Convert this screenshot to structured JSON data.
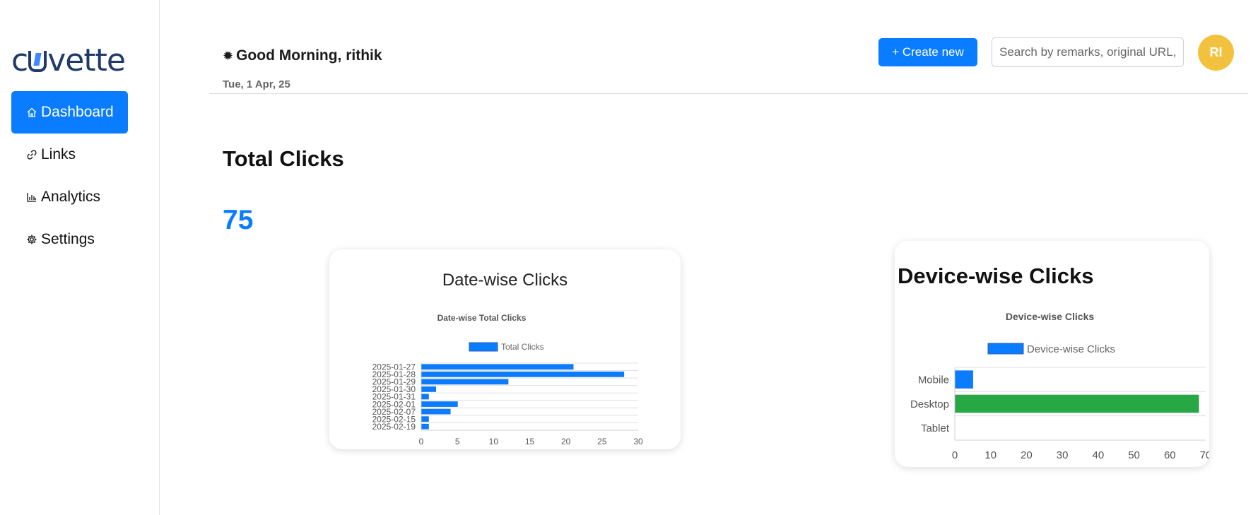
{
  "logo": {
    "text_before": "c",
    "text_after": "vette"
  },
  "sidebar": {
    "items": [
      {
        "label": "Dashboard",
        "icon": "home-icon",
        "active": true
      },
      {
        "label": "Links",
        "icon": "link-icon",
        "active": false
      },
      {
        "label": "Analytics",
        "icon": "bar-chart-icon",
        "active": false
      },
      {
        "label": "Settings",
        "icon": "gear-icon",
        "active": false
      }
    ]
  },
  "header": {
    "greeting": "Good Morning, rithik",
    "date": "Tue, 1 Apr, 25",
    "create_label": "+ Create new",
    "search_placeholder": "Search by remarks, original URL, or short URL",
    "avatar_initials": "RI"
  },
  "summary": {
    "title": "Total Clicks",
    "value": "75"
  },
  "cards": {
    "date_title": "Date-wise Clicks",
    "device_title": "Device-wise Clicks"
  },
  "colors": {
    "accent": "#0a7cff",
    "desktop": "#28a745",
    "avatar": "#f2c13e"
  },
  "chart_data": [
    {
      "type": "bar",
      "orientation": "horizontal",
      "title": "Date-wise Total Clicks",
      "categories": [
        "2025-01-27",
        "2025-01-28",
        "2025-01-29",
        "2025-01-30",
        "2025-01-31",
        "2025-02-01",
        "2025-02-07",
        "2025-02-15",
        "2025-02-19"
      ],
      "series": [
        {
          "name": "Total Clicks",
          "values": [
            21,
            28,
            12,
            2,
            1,
            5,
            4,
            1,
            1
          ],
          "color": "#0a7cff"
        }
      ],
      "xlim": [
        0,
        30
      ],
      "xticks": [
        0,
        5,
        10,
        15,
        20,
        25,
        30
      ],
      "legend": "top",
      "grid": true
    },
    {
      "type": "bar",
      "orientation": "horizontal",
      "title": "Device-wise Clicks",
      "categories": [
        "Mobile",
        "Desktop",
        "Tablet"
      ],
      "series": [
        {
          "name": "Device-wise Clicks",
          "values": [
            5,
            68,
            0
          ],
          "colors": [
            "#0a7cff",
            "#28a745",
            "#0a7cff"
          ]
        }
      ],
      "xlim": [
        0,
        70
      ],
      "xticks": [
        0,
        10,
        20,
        30,
        40,
        50,
        60,
        70
      ],
      "legend": "top",
      "grid": true
    }
  ]
}
